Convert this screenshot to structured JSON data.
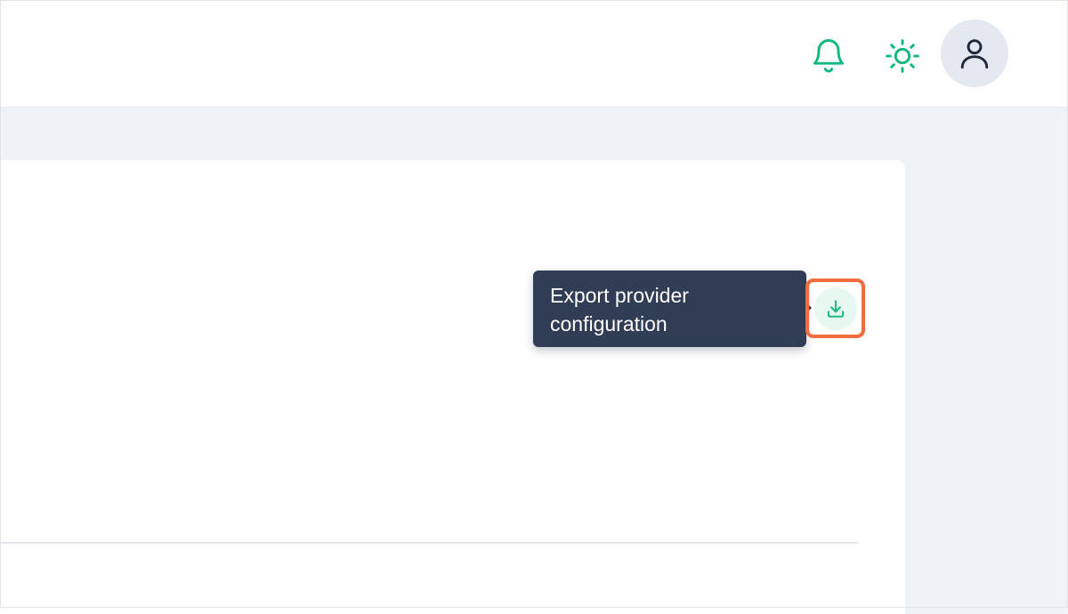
{
  "header": {
    "icons": {
      "notifications": "bell-icon",
      "theme": "sun-icon",
      "user": "user-icon"
    }
  },
  "main": {
    "export_button": {
      "icon": "download-icon",
      "tooltip": "Export provider configuration"
    }
  },
  "colors": {
    "accent": "#10b981",
    "tooltip_bg": "#313d55",
    "highlight": "#f26d3d",
    "page_bg": "#eff2f7",
    "avatar_bg": "#e3e8f1"
  }
}
